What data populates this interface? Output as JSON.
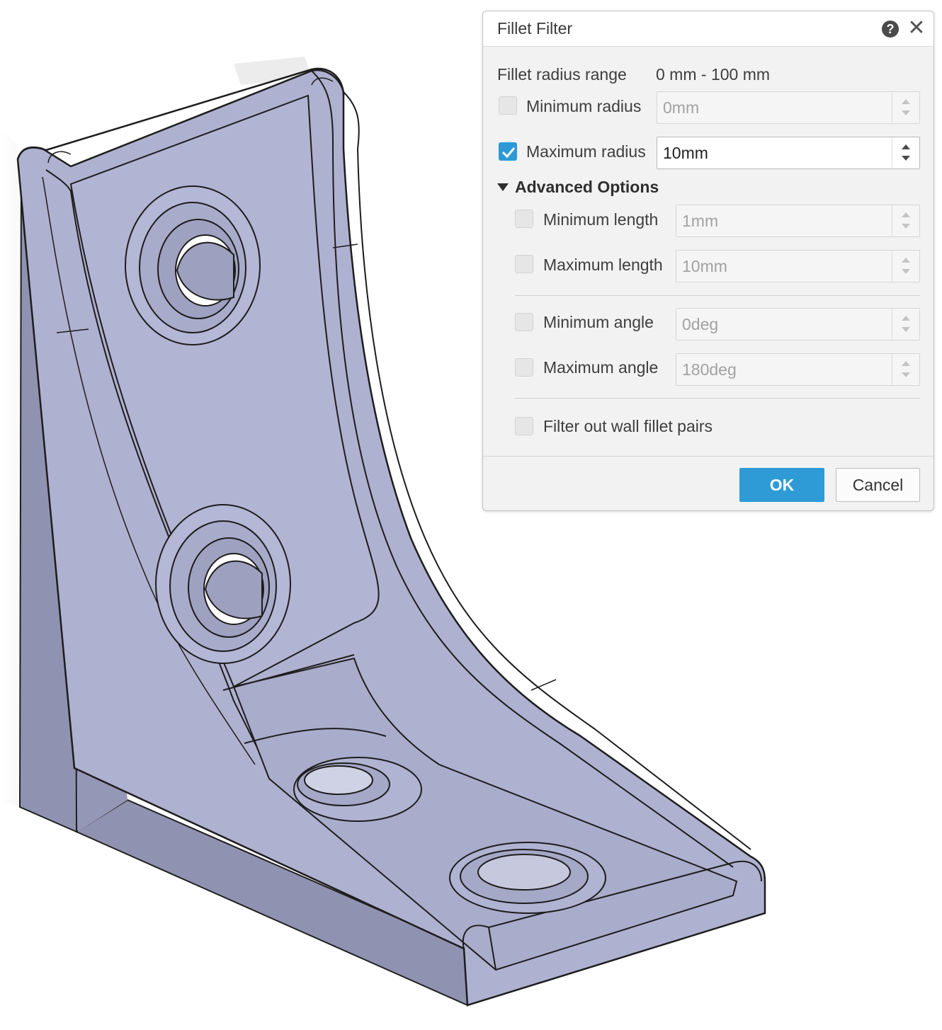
{
  "dialog": {
    "title": "Fillet Filter",
    "help_icon": "?",
    "close_icon": "✕",
    "range_label": "Fillet radius range",
    "range_value": "0 mm - 100 mm",
    "min_radius": {
      "label": "Minimum radius",
      "value": "0mm",
      "checked": false
    },
    "max_radius": {
      "label": "Maximum radius",
      "value": "10mm",
      "checked": true
    },
    "advanced": {
      "label": "Advanced Options",
      "expanded": true,
      "min_length": {
        "label": "Minimum length",
        "value": "1mm",
        "checked": false
      },
      "max_length": {
        "label": "Maximum length",
        "value": "10mm",
        "checked": false
      },
      "min_angle": {
        "label": "Minimum angle",
        "value": "0deg",
        "checked": false
      },
      "max_angle": {
        "label": "Maximum angle",
        "value": "180deg",
        "checked": false
      },
      "wall_pairs": {
        "label": "Filter out wall fillet pairs",
        "checked": false
      }
    },
    "ok_label": "OK",
    "cancel_label": "Cancel"
  },
  "icons": {
    "help": "help-icon",
    "close": "close-icon",
    "collapse": "triangle-down-icon",
    "check": "checkmark-icon"
  },
  "colors": {
    "accent": "#2e9bd6",
    "model_face": "#aeb1cf",
    "model_side": "#9598b6"
  }
}
